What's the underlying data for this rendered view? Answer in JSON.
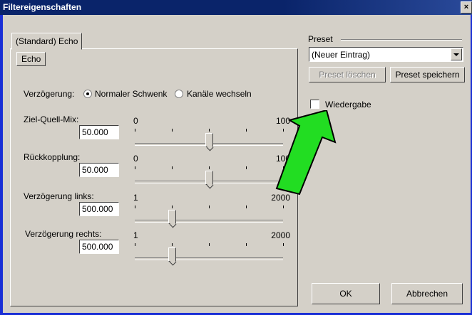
{
  "window": {
    "title": "Filtereigenschaften"
  },
  "tabs": {
    "main": "(Standard) Echo",
    "sub": "Echo"
  },
  "delay_mode": {
    "label": "Verzögerung:",
    "options": [
      "Normaler Schwenk",
      "Kanäle wechseln"
    ],
    "selected": "Normaler Schwenk"
  },
  "sliders": [
    {
      "label": "Ziel-Quell-Mix:",
      "value": "50.000",
      "min": "0",
      "max": "100",
      "fraction": 0.5
    },
    {
      "label": "Rückkopplung:",
      "value": "50.000",
      "min": "0",
      "max": "100",
      "fraction": 0.5
    },
    {
      "label": "Verzögerung links:",
      "value": "500.000",
      "min": "1",
      "max": "2000",
      "fraction": 0.25
    },
    {
      "label": "Verzögerung rechts:",
      "value": "500.000",
      "min": "1",
      "max": "2000",
      "fraction": 0.25
    }
  ],
  "preset": {
    "label": "Preset",
    "selected": "(Neuer Eintrag)",
    "delete_label": "Preset löschen",
    "save_label": "Preset speichern"
  },
  "playback": {
    "label": "Wiedergabe",
    "checked": false
  },
  "buttons": {
    "ok": "OK",
    "cancel": "Abbrechen"
  },
  "annotation": {
    "arrow_color": "#22dd22"
  }
}
